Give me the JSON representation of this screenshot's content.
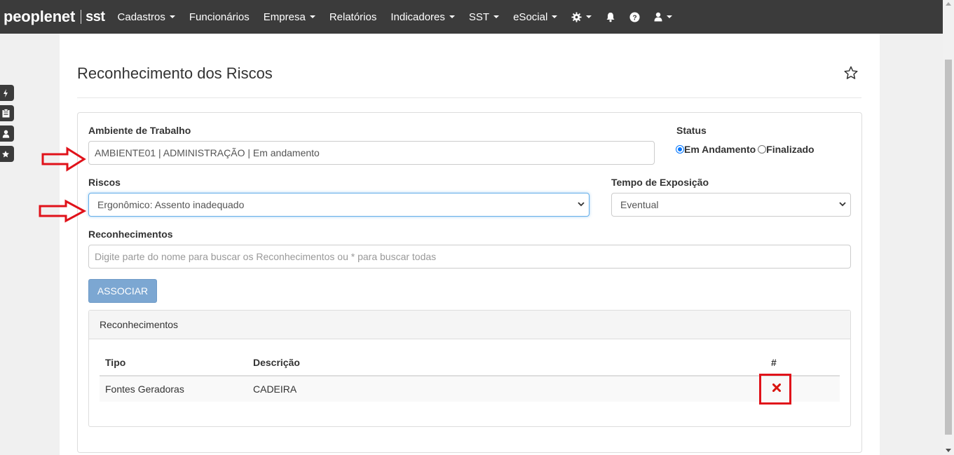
{
  "nav": {
    "logo_main": "peoplenet",
    "logo_sub": "sst",
    "menu": [
      {
        "label": "Cadastros",
        "dropdown": true
      },
      {
        "label": "Funcionários",
        "dropdown": false
      },
      {
        "label": "Empresa",
        "dropdown": true
      },
      {
        "label": "Relatórios",
        "dropdown": false
      },
      {
        "label": "Indicadores",
        "dropdown": true
      },
      {
        "label": "SST",
        "dropdown": true
      },
      {
        "label": "eSocial",
        "dropdown": true
      }
    ],
    "icons": [
      "gear-icon",
      "bell-icon",
      "help-icon",
      "user-icon"
    ]
  },
  "side_menu": [
    "bolt-icon",
    "clipboard-icon",
    "user-icon",
    "star-icon"
  ],
  "page": {
    "title": "Reconhecimento dos Riscos"
  },
  "form": {
    "ambiente_label": "Ambiente de Trabalho",
    "ambiente_value": "AMBIENTE01 | ADMINISTRAÇÃO | Em andamento",
    "status_label": "Status",
    "status_options": [
      "Em Andamento",
      "Finalizado"
    ],
    "status_selected": "Em Andamento",
    "riscos_label": "Riscos",
    "riscos_value": "Ergonômico: Assento inadequado",
    "tempo_label": "Tempo de Exposição",
    "tempo_value": "Eventual",
    "reconhecimentos_label": "Reconhecimentos",
    "reconhecimentos_placeholder": "Digite parte do nome para buscar os Reconhecimentos ou * para buscar todas",
    "associar_label": "ASSOCIAR"
  },
  "table": {
    "panel_title": "Reconhecimentos",
    "headers": [
      "Tipo",
      "Descrição",
      "#"
    ],
    "rows": [
      {
        "tipo": "Fontes Geradoras",
        "descricao": "CADEIRA",
        "action": "delete-icon"
      }
    ]
  },
  "colors": {
    "navbar": "#3b3b3b",
    "button_primary": "#7ca7d2",
    "delete": "#d9140e",
    "annotation": "#e0121a"
  }
}
